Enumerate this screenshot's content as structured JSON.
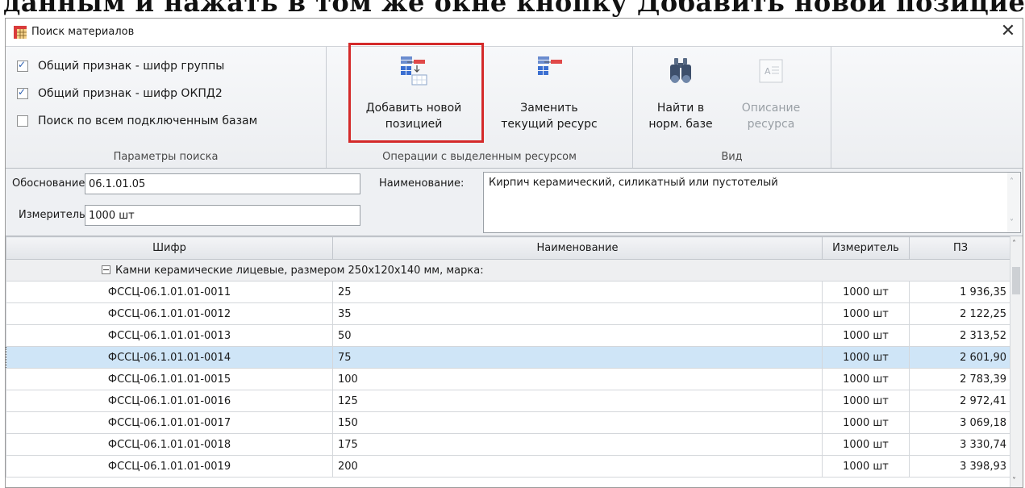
{
  "doc_caption": "данным и нажать в том же окне кнопку Добавить новой позицией:",
  "window": {
    "title": "Поиск материалов"
  },
  "ribbon": {
    "search_params": {
      "label": "Параметры поиска",
      "options": [
        {
          "label": "Общий признак - шифр группы",
          "checked": true
        },
        {
          "label": "Общий признак - шифр ОКПД2",
          "checked": true
        },
        {
          "label": "Поиск по всем подключенным базам",
          "checked": false
        }
      ]
    },
    "operations": {
      "label": "Операции с выделенным ресурсом",
      "add_line1": "Добавить новой",
      "add_line2": "позицией",
      "replace_line1": "Заменить",
      "replace_line2": "текущий ресурс"
    },
    "view": {
      "label": "Вид",
      "find_line1": "Найти в",
      "find_line2": "норм. базе",
      "desc_line1": "Описание",
      "desc_line2": "ресурса"
    }
  },
  "fields": {
    "basis_label": "Обоснование:",
    "basis_value": "06.1.01.05",
    "unit_label": "Измеритель:",
    "unit_value": "1000 шт",
    "name_label": "Наименование:",
    "name_value": "Кирпич керамический, силикатный или пустотелый"
  },
  "table": {
    "columns": [
      "Шифр",
      "Наименование",
      "Измеритель",
      "ПЗ"
    ],
    "group_title": "Камни керамические лицевые, размером 250х120х140 мм, марка:",
    "rows": [
      {
        "code": "ФССЦ-06.1.01.01-0011",
        "name": "25",
        "unit": "1000 шт",
        "price": "1 936,35"
      },
      {
        "code": "ФССЦ-06.1.01.01-0012",
        "name": "35",
        "unit": "1000 шт",
        "price": "2 122,25"
      },
      {
        "code": "ФССЦ-06.1.01.01-0013",
        "name": "50",
        "unit": "1000 шт",
        "price": "2 313,52"
      },
      {
        "code": "ФССЦ-06.1.01.01-0014",
        "name": "75",
        "unit": "1000 шт",
        "price": "2 601,90"
      },
      {
        "code": "ФССЦ-06.1.01.01-0015",
        "name": "100",
        "unit": "1000 шт",
        "price": "2 783,39"
      },
      {
        "code": "ФССЦ-06.1.01.01-0016",
        "name": "125",
        "unit": "1000 шт",
        "price": "2 972,41"
      },
      {
        "code": "ФССЦ-06.1.01.01-0017",
        "name": "150",
        "unit": "1000 шт",
        "price": "3 069,18"
      },
      {
        "code": "ФССЦ-06.1.01.01-0018",
        "name": "175",
        "unit": "1000 шт",
        "price": "3 330,74"
      },
      {
        "code": "ФССЦ-06.1.01.01-0019",
        "name": "200",
        "unit": "1000 шт",
        "price": "3 398,93"
      }
    ],
    "selected_index": 3
  },
  "icons": {
    "app": "grid-table-icon",
    "close": "close-icon",
    "add": "add-position-icon",
    "replace": "replace-resource-icon",
    "find": "binoculars-icon",
    "description": "document-description-icon"
  },
  "colors": {
    "highlight": "#d42a2a",
    "selection": "#cfe5f7"
  }
}
